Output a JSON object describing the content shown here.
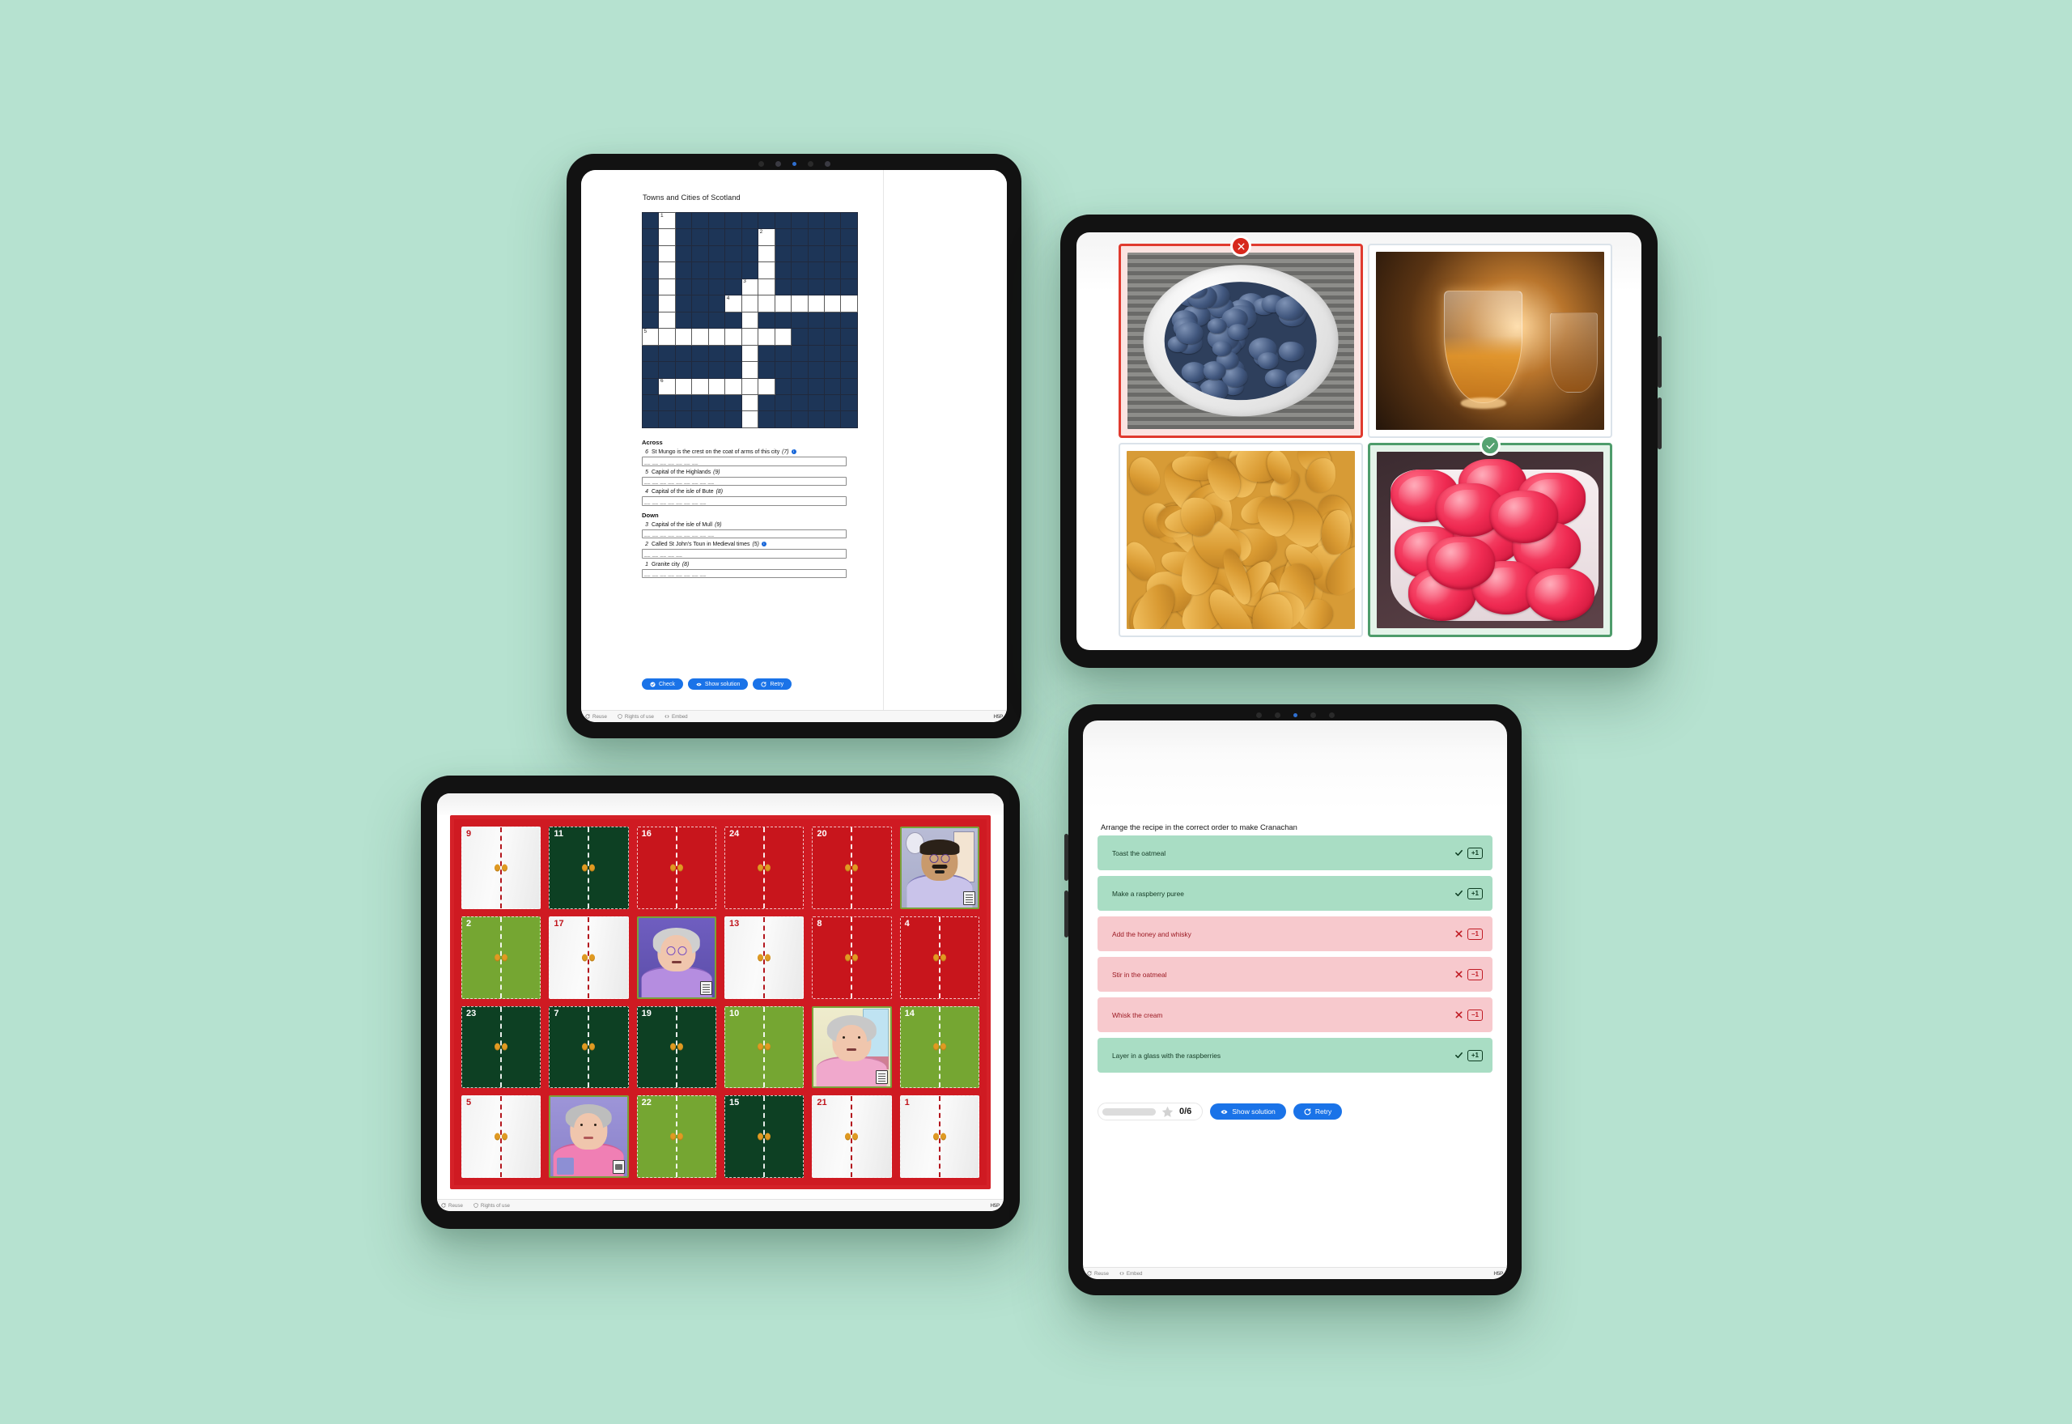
{
  "background_color": "#b6e2d0",
  "crossword": {
    "title": "Towns and Cities of Scotland",
    "grid": {
      "cols": 13,
      "rows": 13,
      "fill_color": "#1d3557",
      "cells": [
        {
          "r": 0,
          "c": 1,
          "n": "1"
        },
        {
          "r": 1,
          "c": 1
        },
        {
          "r": 1,
          "c": 7,
          "n": "2"
        },
        {
          "r": 2,
          "c": 1
        },
        {
          "r": 2,
          "c": 7
        },
        {
          "r": 3,
          "c": 1
        },
        {
          "r": 3,
          "c": 7
        },
        {
          "r": 4,
          "c": 1
        },
        {
          "r": 4,
          "c": 6,
          "n": "3"
        },
        {
          "r": 4,
          "c": 7
        },
        {
          "r": 5,
          "c": 1
        },
        {
          "r": 5,
          "c": 5,
          "n": "4"
        },
        {
          "r": 5,
          "c": 6
        },
        {
          "r": 5,
          "c": 7
        },
        {
          "r": 5,
          "c": 8
        },
        {
          "r": 5,
          "c": 9
        },
        {
          "r": 5,
          "c": 10
        },
        {
          "r": 5,
          "c": 11
        },
        {
          "r": 5,
          "c": 12
        },
        {
          "r": 6,
          "c": 1
        },
        {
          "r": 6,
          "c": 6
        },
        {
          "r": 7,
          "c": 0,
          "n": "5"
        },
        {
          "r": 7,
          "c": 1
        },
        {
          "r": 7,
          "c": 2
        },
        {
          "r": 7,
          "c": 3
        },
        {
          "r": 7,
          "c": 4
        },
        {
          "r": 7,
          "c": 5
        },
        {
          "r": 7,
          "c": 6
        },
        {
          "r": 7,
          "c": 7
        },
        {
          "r": 7,
          "c": 8
        },
        {
          "r": 8,
          "c": 6
        },
        {
          "r": 9,
          "c": 6
        },
        {
          "r": 10,
          "c": 1,
          "n": "6"
        },
        {
          "r": 10,
          "c": 2
        },
        {
          "r": 10,
          "c": 3
        },
        {
          "r": 10,
          "c": 4
        },
        {
          "r": 10,
          "c": 5
        },
        {
          "r": 10,
          "c": 6
        },
        {
          "r": 10,
          "c": 7
        },
        {
          "r": 11,
          "c": 6
        },
        {
          "r": 12,
          "c": 6
        }
      ]
    },
    "across_heading": "Across",
    "down_heading": "Down",
    "across": [
      {
        "num": "6",
        "text": "St Mungo is the crest on the coat of arms of this city",
        "length": "(7)",
        "info": true,
        "value": "",
        "dashes": "__ __ __ __ __ __ __"
      },
      {
        "num": "5",
        "text": "Capital of the Highlands",
        "length": "(9)",
        "info": false,
        "value": "",
        "dashes": "__ __ __ __ __ __ __ __ __"
      },
      {
        "num": "4",
        "text": "Capital of the isle of Bute",
        "length": "(8)",
        "info": false,
        "value": "",
        "dashes": "__ __ __ __ __ __ __ __"
      }
    ],
    "down": [
      {
        "num": "3",
        "text": "Capital of the isle of Mull",
        "length": "(9)",
        "info": false,
        "value": "",
        "dashes": "__ __ __ __ __ __ __ __ __"
      },
      {
        "num": "2",
        "text": "Called St John's Toun in Medieval times",
        "length": "(5)",
        "info": true,
        "value": "",
        "dashes": "__ __ __ __ __"
      },
      {
        "num": "1",
        "text": "Granite city",
        "length": "(8)",
        "info": false,
        "value": "",
        "dashes": "__ __ __ __ __ __ __ __"
      }
    ],
    "buttons": {
      "check": "Check",
      "show_solution": "Show solution",
      "retry": "Retry"
    },
    "footer": {
      "reuse": "Reuse",
      "rights": "Rights of use",
      "embed": "Embed",
      "logo": "H5P"
    },
    "accent_color": "#1a73e8"
  },
  "image_choice": {
    "cards": [
      {
        "name": "blueberries",
        "state": "wrong",
        "badge": "x",
        "border_color": "#e03a2f"
      },
      {
        "name": "whisky-glass",
        "state": "neutral",
        "badge": "",
        "border_color": "#dbe3ea"
      },
      {
        "name": "cornflakes",
        "state": "neutral",
        "badge": "",
        "border_color": "#dbe3ea"
      },
      {
        "name": "raspberries",
        "state": "right",
        "badge": "check",
        "border_color": "#4e9c6b"
      }
    ]
  },
  "advent": {
    "board_color": "#cf1a22",
    "doors": [
      {
        "num": "9",
        "color": "c-light",
        "open": false
      },
      {
        "num": "11",
        "color": "c-dark",
        "open": false
      },
      {
        "num": "16",
        "color": "c-red",
        "open": false
      },
      {
        "num": "24",
        "color": "c-red",
        "open": false
      },
      {
        "num": "20",
        "color": "c-red",
        "open": false
      },
      {
        "num": "",
        "color": "c-red",
        "open": true,
        "portrait": "man-glasses-moustache",
        "doc": "document"
      },
      {
        "num": "2",
        "color": "c-green",
        "open": false
      },
      {
        "num": "17",
        "color": "c-light",
        "open": false
      },
      {
        "num": "",
        "color": "c-green",
        "open": true,
        "portrait": "woman-purple-glasses",
        "doc": "document"
      },
      {
        "num": "13",
        "color": "c-light",
        "open": false
      },
      {
        "num": "8",
        "color": "c-red",
        "open": false
      },
      {
        "num": "4",
        "color": "c-red",
        "open": false
      },
      {
        "num": "23",
        "color": "c-dark",
        "open": false
      },
      {
        "num": "7",
        "color": "c-dark",
        "open": false
      },
      {
        "num": "19",
        "color": "c-dark",
        "open": false
      },
      {
        "num": "10",
        "color": "c-green",
        "open": false
      },
      {
        "num": "",
        "color": "c-dark",
        "open": true,
        "portrait": "woman-grey-hair-pink",
        "doc": "document"
      },
      {
        "num": "14",
        "color": "c-green",
        "open": false
      },
      {
        "num": "5",
        "color": "c-light",
        "open": false
      },
      {
        "num": "",
        "color": "c-light",
        "open": true,
        "portrait": "older-woman-pink-mug",
        "doc": "image"
      },
      {
        "num": "22",
        "color": "c-green",
        "open": false
      },
      {
        "num": "15",
        "color": "c-dark",
        "open": false
      },
      {
        "num": "21",
        "color": "c-light",
        "open": false
      },
      {
        "num": "1",
        "color": "c-light",
        "open": false
      }
    ],
    "footer": {
      "reuse": "Reuse",
      "rights": "Rights of use",
      "logo": "H5P"
    }
  },
  "sequence": {
    "prompt": "Arrange the recipe in the correct order to make Cranachan",
    "items": [
      {
        "label": "Toast the oatmeal",
        "state": "ok",
        "points": "+1"
      },
      {
        "label": "Make a raspberry puree",
        "state": "ok",
        "points": "+1"
      },
      {
        "label": "Add the honey and whisky",
        "state": "no",
        "points": "−1"
      },
      {
        "label": "Stir in the oatmeal",
        "state": "no",
        "points": "−1"
      },
      {
        "label": "Whisk the cream",
        "state": "no",
        "points": "−1"
      },
      {
        "label": "Layer in a glass with the raspberries",
        "state": "ok",
        "points": "+1"
      }
    ],
    "score": "0/6",
    "progress_percent": 0,
    "buttons": {
      "show_solution": "Show solution",
      "retry": "Retry"
    },
    "footer": {
      "reuse": "Reuse",
      "embed": "Embed",
      "logo": "H5P"
    },
    "accent_color": "#1a73e8"
  }
}
